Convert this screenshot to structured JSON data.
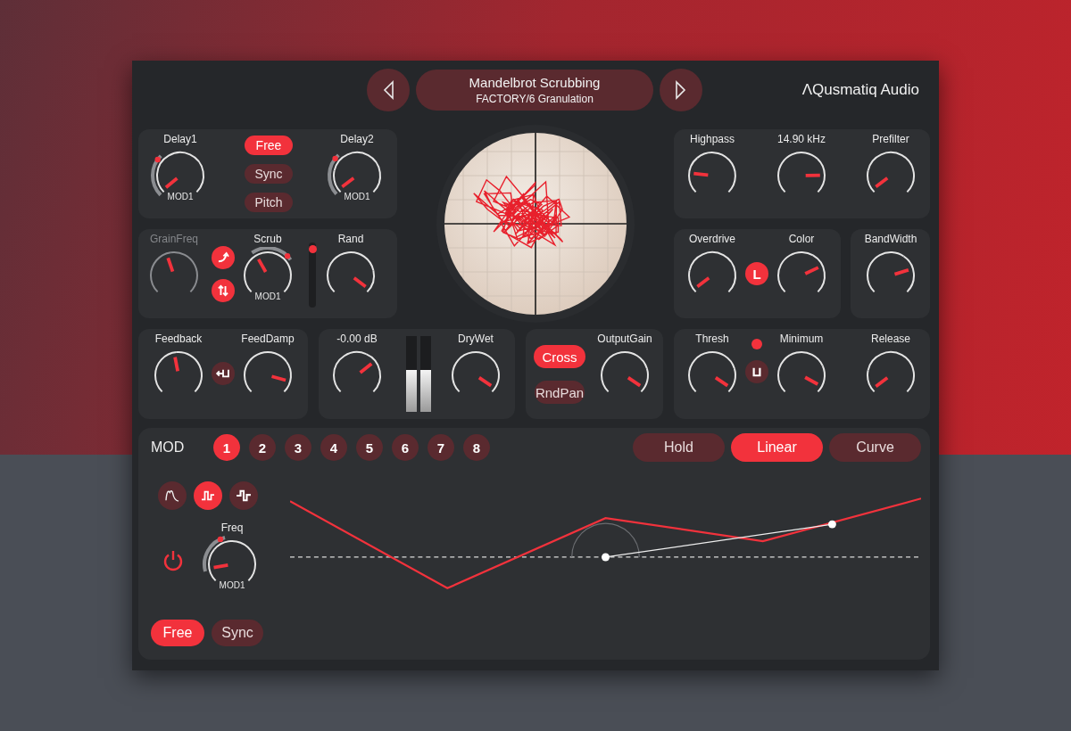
{
  "header": {
    "preset_name": "Mandelbrot Scrubbing",
    "preset_path": "FACTORY/6 Granulation",
    "brand": "ΛQusmatiq Audio"
  },
  "delay": {
    "knobs": [
      {
        "label": "Delay1",
        "level": 0.02,
        "mod_label": "MOD1"
      },
      {
        "label": "Delay2",
        "level": 0.03,
        "mod_label": "MOD1"
      }
    ],
    "modes": [
      {
        "label": "Free",
        "selected": true
      },
      {
        "label": "Sync",
        "selected": false
      },
      {
        "label": "Pitch",
        "selected": false
      }
    ]
  },
  "grain": {
    "grain_freq": {
      "label": "GrainFreq",
      "level": 0.43,
      "disabled": true
    },
    "toggles": [
      {
        "kind": "curve",
        "on": true
      },
      {
        "kind": "swap",
        "on": true
      }
    ],
    "scrub": {
      "label": "Scrub",
      "level": 0.39,
      "mod_label": "MOD1"
    },
    "slider": {
      "level": 0.95
    },
    "rand": {
      "label": "Rand",
      "level": 0.97
    }
  },
  "feedback": {
    "feedback": {
      "label": "Feedback",
      "level": 0.46
    },
    "toggle": {
      "kind": "feedback",
      "on": false
    },
    "feed_damp": {
      "label": "FeedDamp",
      "level": 0.89
    }
  },
  "output": {
    "gain": {
      "label": "-0.00 dB",
      "level": 0.69
    },
    "meters": [
      {
        "level": 0.55
      },
      {
        "level": 0.55
      }
    ],
    "dry_wet": {
      "label": "DryWet",
      "level": 0.96
    }
  },
  "stereo": {
    "modes": [
      {
        "label": "Cross",
        "selected": true
      },
      {
        "label": "RndPan",
        "selected": false
      }
    ],
    "output_gain": {
      "label": "OutputGain",
      "level": 0.96
    }
  },
  "filter": {
    "knobs": [
      {
        "label": "Highpass",
        "level": 0.19
      },
      {
        "label": "14.90 kHz",
        "level": 0.83
      },
      {
        "label": "Prefilter",
        "level": 0.03
      }
    ]
  },
  "drive": {
    "overdrive": {
      "label": "Overdrive",
      "level": 0.03
    },
    "toggle": {
      "text": "L",
      "on": true
    },
    "color": {
      "label": "Color",
      "level": 0.74
    }
  },
  "bandwidth": {
    "label": "BandWidth",
    "level": 0.77
  },
  "dynamics": {
    "thresh": {
      "label": "Thresh",
      "level": 0.96
    },
    "led": {
      "on": true
    },
    "toggle": {
      "kind": "gate",
      "on": false
    },
    "minimum": {
      "label": "Minimum",
      "level": 0.94
    },
    "release": {
      "label": "Release",
      "level": 0.03
    }
  },
  "mod": {
    "title": "MOD",
    "tabs": [
      {
        "label": "1",
        "selected": true
      },
      {
        "label": "2",
        "selected": false
      },
      {
        "label": "3",
        "selected": false
      },
      {
        "label": "4",
        "selected": false
      },
      {
        "label": "5",
        "selected": false
      },
      {
        "label": "6",
        "selected": false
      },
      {
        "label": "7",
        "selected": false
      },
      {
        "label": "8",
        "selected": false
      }
    ],
    "interpolation": [
      {
        "label": "Hold",
        "selected": false
      },
      {
        "label": "Linear",
        "selected": true
      },
      {
        "label": "Curve",
        "selected": false
      }
    ],
    "shapes": [
      {
        "kind": "smooth",
        "selected": false
      },
      {
        "kind": "square",
        "selected": true
      },
      {
        "kind": "step",
        "selected": false
      }
    ],
    "power": {
      "on": true
    },
    "freq": {
      "label": "Freq",
      "level": 0.13,
      "mod_label": "MOD1"
    },
    "sync_modes": [
      {
        "label": "Free",
        "selected": true
      },
      {
        "label": "Sync",
        "selected": false
      }
    ]
  }
}
